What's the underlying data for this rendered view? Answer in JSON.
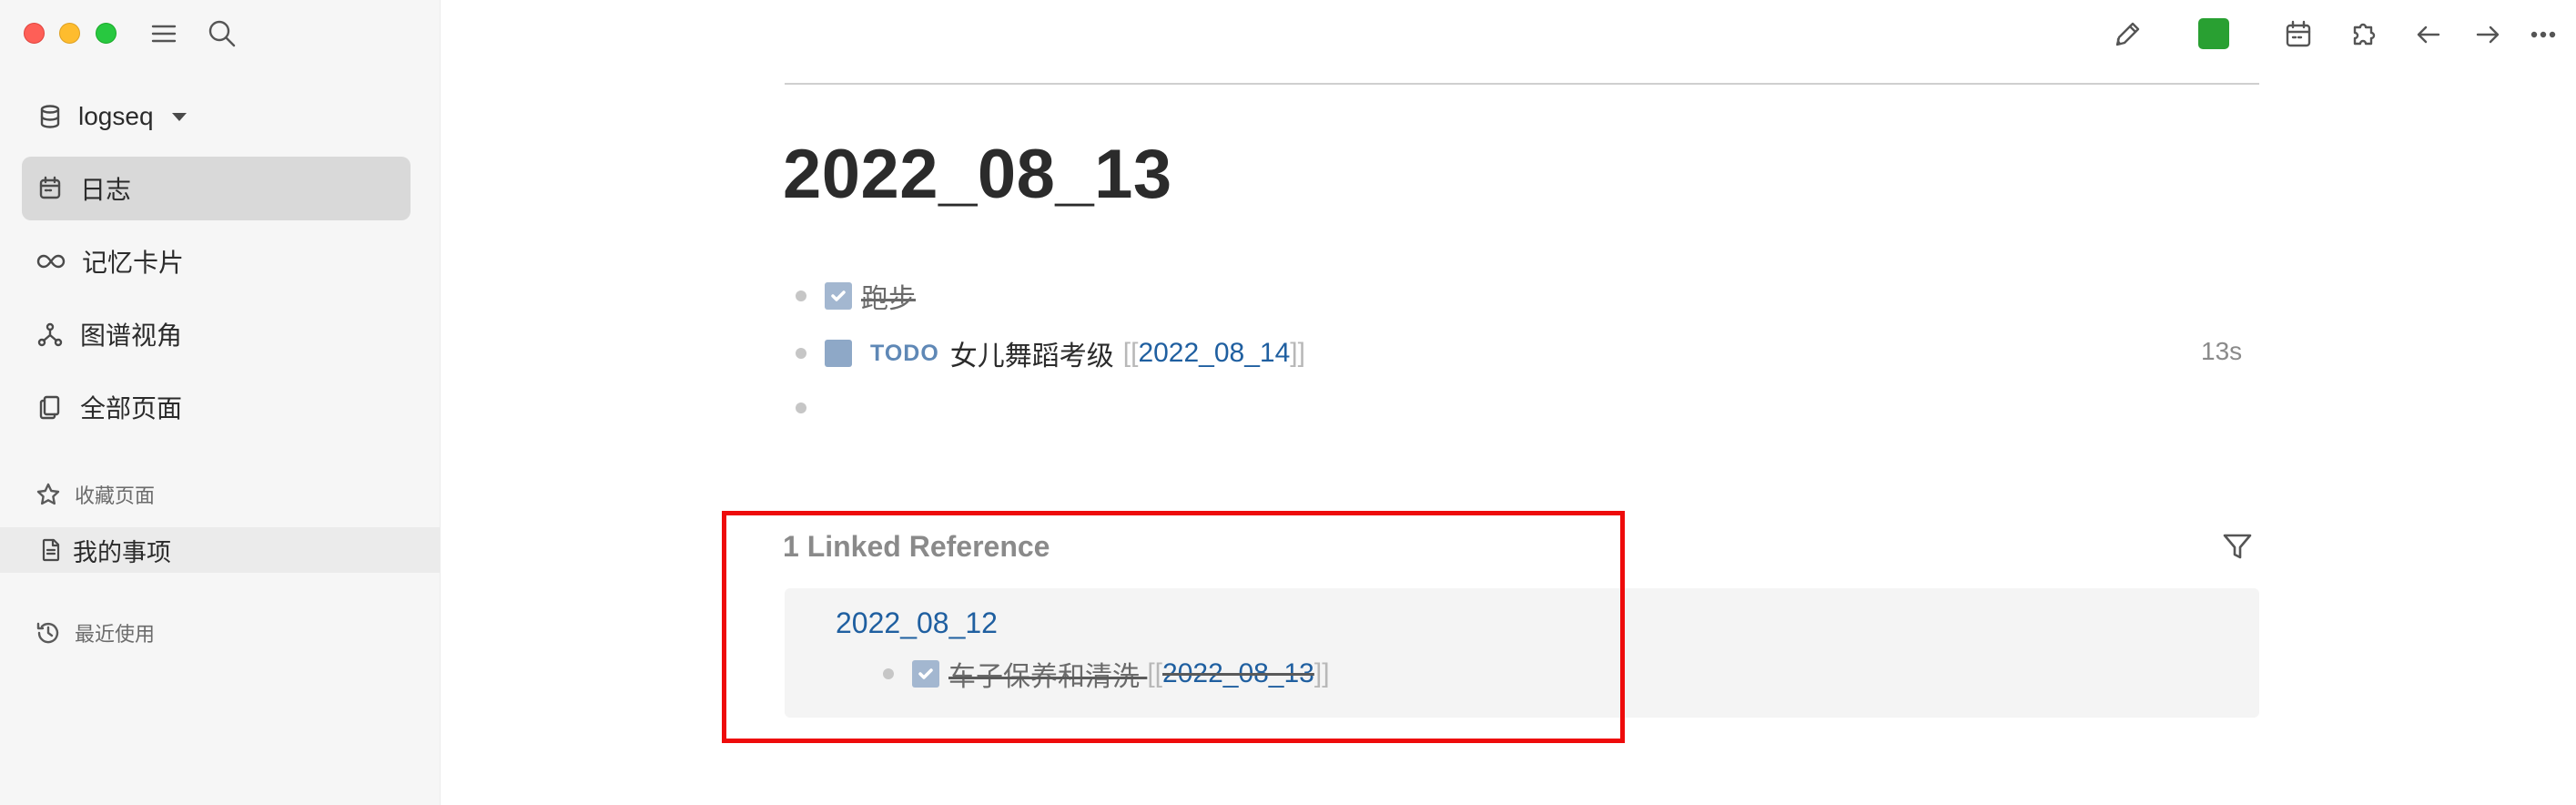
{
  "app": {
    "accent": "#1f5fa0",
    "sync_status_color": "#29a032"
  },
  "window_controls": [
    "close",
    "minimize",
    "zoom"
  ],
  "sidebar": {
    "graph_name": "logseq",
    "nav": [
      {
        "label": "日志",
        "icon": "calendar-icon",
        "active": true
      },
      {
        "label": "记忆卡片",
        "icon": "infinity-icon",
        "active": false
      },
      {
        "label": "图谱视角",
        "icon": "graph-icon",
        "active": false
      },
      {
        "label": "全部页面",
        "icon": "pages-icon",
        "active": false
      }
    ],
    "favorites_title": "收藏页面",
    "favorites": [
      {
        "label": "我的事项"
      }
    ],
    "recent_title": "最近使用"
  },
  "toolbar": {
    "icons": [
      "pencil-icon",
      "sync-status-icon",
      "calendar-icon",
      "plugins-icon",
      "back-arrow-icon",
      "forward-arrow-icon",
      "more-icon"
    ]
  },
  "page": {
    "title": "2022_08_13",
    "blocks": [
      {
        "status": "DONE",
        "text": "跑步"
      },
      {
        "status": "TODO",
        "marker": "TODO",
        "text": "女儿舞蹈考级",
        "ref_open": "[[",
        "ref": "2022_08_14",
        "ref_close": "]]",
        "timer": "13s"
      },
      {
        "status": "empty"
      }
    ]
  },
  "references": {
    "title": "1 Linked Reference",
    "items": [
      {
        "page": "2022_08_12",
        "block": {
          "status": "DONE",
          "text": "车子保养和清洗 ",
          "ref_open": "[[",
          "ref": "2022_08_13",
          "ref_close": "]]"
        }
      }
    ]
  }
}
